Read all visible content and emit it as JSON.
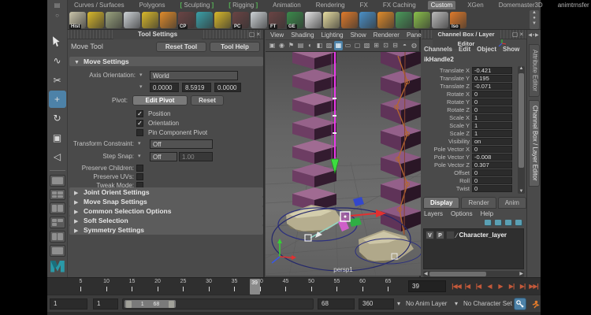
{
  "colors": {
    "accent_blue": "#4d82a8",
    "playback_orange": "#c4593a",
    "bracket_green": "#56b456",
    "selection_pink": "#e83ae8"
  },
  "shelf": {
    "tabs": [
      {
        "label": "Curves / Surfaces"
      },
      {
        "label": "Polygons"
      },
      {
        "label": "Sculpting",
        "bracketed": true
      },
      {
        "label": "Rigging",
        "bracketed": true
      },
      {
        "label": "Animation"
      },
      {
        "label": "Rendering"
      },
      {
        "label": "FX"
      },
      {
        "label": "FX Caching"
      },
      {
        "label": "Custom",
        "active": true
      },
      {
        "label": "XGen"
      },
      {
        "label": "Domemaster3D"
      },
      {
        "label": "animtrnsfer"
      }
    ],
    "icons": [
      {
        "name": "history-icon",
        "color": "#c9c4aa",
        "badge": "Hist"
      },
      {
        "name": "yellow-lattice-icon",
        "color": "#d8b82a"
      },
      {
        "name": "mesh-icon",
        "color": "#9aa37e"
      },
      {
        "name": "knife-icon",
        "color": "#cdd2d6"
      },
      {
        "name": "lattice-icon",
        "color": "#d8b82a"
      },
      {
        "name": "cylinder-icon",
        "color": "#e08b2a"
      },
      {
        "name": "cp-tool-icon",
        "color": "#6a4444",
        "badge": "CP"
      },
      {
        "name": "editor-panel-icon",
        "color": "#3aa0a8"
      },
      {
        "name": "net-icon",
        "color": "#d8b82a"
      },
      {
        "name": "pc-tool-icon",
        "color": "#6a4444",
        "badge": "PC"
      },
      {
        "name": "knife2-icon",
        "color": "#cdd2d6"
      },
      {
        "name": "ft-tool-icon",
        "color": "#6a4444",
        "badge": "FT"
      },
      {
        "name": "ge-tool-icon",
        "color": "#3a8a4a",
        "badge": "GE"
      },
      {
        "name": "white-panel-icon",
        "color": "#e4e4e4"
      },
      {
        "name": "cone-icon",
        "color": "#e6dca0"
      },
      {
        "name": "orange-grid-icon",
        "color": "#e07a2a"
      },
      {
        "name": "blue-brush-icon",
        "color": "#4a90c8"
      },
      {
        "name": "orange-sphere-icon",
        "color": "#e08b2a"
      },
      {
        "name": "green-box-icon",
        "color": "#4a9a5a"
      },
      {
        "name": "green-circle-brush-icon",
        "color": "#8ac04a"
      },
      {
        "name": "brackets-icon",
        "color": "#bbbbbb"
      },
      {
        "name": "iso-house-icon",
        "color": "#e07a2a",
        "badge": "Iso"
      }
    ]
  },
  "toolbox": {
    "tools": [
      {
        "name": "select-tool",
        "glyph": "cursor"
      },
      {
        "name": "lasso-select-tool",
        "glyph": "∿"
      },
      {
        "name": "paint-select-tool",
        "glyph": "✂"
      },
      {
        "name": "move-tool",
        "glyph": "+",
        "active": true
      },
      {
        "name": "rotate-tool",
        "glyph": "↻"
      },
      {
        "name": "scale-tool",
        "glyph": "▣"
      },
      {
        "name": "last-tool",
        "glyph": "◁"
      }
    ],
    "layouts": [
      {
        "name": "layout-single-pane-button",
        "panes": 1
      },
      {
        "name": "layout-four-pane-button",
        "panes": 4
      },
      {
        "name": "layout-two-pane-side-button",
        "panes": 2
      },
      {
        "name": "layout-three-pane-button",
        "panes": 3
      },
      {
        "name": "layout-outliner-persp-button",
        "panes": 2
      },
      {
        "name": "layout-custom-button",
        "panes": 1
      }
    ]
  },
  "tool_settings": {
    "title": "Tool Settings",
    "tool_name": "Move Tool",
    "reset_button": "Reset Tool",
    "help_button": "Tool Help",
    "move_settings_header": "Move Settings",
    "axis_orientation_label": "Axis Orientation:",
    "axis_orientation_value": "World",
    "translate_values": [
      "0.0000",
      "8.5919",
      "0.0000"
    ],
    "pivot_label": "Pivot:",
    "edit_pivot_button": "Edit Pivot",
    "pivot_reset_button": "Reset",
    "checkboxes": [
      {
        "label": "Position",
        "checked": true
      },
      {
        "label": "Orientation",
        "checked": true
      },
      {
        "label": "Pin Component Pivot",
        "checked": false
      }
    ],
    "transform_constraint_label": "Transform Constraint:",
    "transform_constraint_value": "Off",
    "step_snap_label": "Step Snap:",
    "step_snap_value": "Off",
    "step_snap_increment": "1.00",
    "toggle_rows": [
      {
        "label": "Preserve Children:",
        "checked": false
      },
      {
        "label": "Preserve UVs:",
        "checked": false
      },
      {
        "label": "Tweak Mode:",
        "checked": false
      }
    ],
    "collapsed_sections": [
      "Joint Orient Settings",
      "Move Snap Settings",
      "Common Selection Options",
      "Soft Selection",
      "Symmetry Settings"
    ]
  },
  "viewport": {
    "menus": [
      "View",
      "Shading",
      "Lighting",
      "Show",
      "Renderer",
      "Panels"
    ],
    "icons": [
      {
        "name": "select-camera-icon",
        "glyph": "▣"
      },
      {
        "name": "camera-attributes-icon",
        "glyph": "◉"
      },
      {
        "name": "bookmark-icon",
        "glyph": "⚑"
      },
      {
        "name": "image-plane-icon",
        "glyph": "▤"
      },
      {
        "name": "two-sided-lighting-icon",
        "glyph": "◐"
      },
      {
        "name": "shading-icon",
        "glyph": "◧"
      },
      {
        "name": "textured-icon",
        "glyph": "▨"
      },
      {
        "name": "grid-icon",
        "glyph": "▦",
        "active": true
      },
      {
        "name": "film-gate-icon",
        "glyph": "▭"
      },
      {
        "name": "resolution-gate-icon",
        "glyph": "▢"
      },
      {
        "name": "gate-mask-icon",
        "glyph": "▧"
      },
      {
        "name": "field-chart-icon",
        "glyph": "⊞"
      },
      {
        "name": "safe-action-icon",
        "glyph": "⊡"
      },
      {
        "name": "safe-title-icon",
        "glyph": "⊟"
      },
      {
        "name": "frame-rate-icon",
        "glyph": "◓"
      },
      {
        "name": "xray-icon",
        "glyph": "◍"
      }
    ],
    "camera_label": "persp1"
  },
  "channel_box": {
    "title": "Channel Box / Layer Editor",
    "menus": [
      "Channels",
      "Edit",
      "Object",
      "Show"
    ],
    "object_name": "ikHandle2",
    "channels": [
      {
        "label": "Translate X",
        "value": "-0.421"
      },
      {
        "label": "Translate Y",
        "value": "0.195"
      },
      {
        "label": "Translate Z",
        "value": "-0.071"
      },
      {
        "label": "Rotate X",
        "value": "0"
      },
      {
        "label": "Rotate Y",
        "value": "0"
      },
      {
        "label": "Rotate Z",
        "value": "0"
      },
      {
        "label": "Scale X",
        "value": "1"
      },
      {
        "label": "Scale Y",
        "value": "1"
      },
      {
        "label": "Scale Z",
        "value": "1"
      },
      {
        "label": "Visibility",
        "value": "on"
      },
      {
        "label": "Pole Vector X",
        "value": "0"
      },
      {
        "label": "Pole Vector Y",
        "value": "-0.008"
      },
      {
        "label": "Pole Vector Z",
        "value": "0.307"
      },
      {
        "label": "Offset",
        "value": "0"
      },
      {
        "label": "Roll",
        "value": "0"
      },
      {
        "label": "Twist",
        "value": "0"
      }
    ]
  },
  "layer_editor": {
    "tabs": [
      {
        "label": "Display",
        "active": true
      },
      {
        "label": "Render",
        "active": false
      },
      {
        "label": "Anim",
        "active": false
      }
    ],
    "menus": [
      "Layers",
      "Options",
      "Help"
    ],
    "layers": [
      {
        "visibility": "V",
        "playback": "P",
        "name": "Character_layer"
      }
    ]
  },
  "side_tabs": [
    "Attribute Editor",
    "Channel Box / Layer Editor"
  ],
  "timeline": {
    "ticks": [
      5,
      10,
      15,
      20,
      25,
      30,
      35,
      40,
      45,
      50,
      55,
      60,
      65
    ],
    "current_frame": 39,
    "current_frame_field": "39"
  },
  "playback_buttons": [
    {
      "name": "go-to-start-button",
      "glyph": "|◀◀"
    },
    {
      "name": "step-back-frame-button",
      "glyph": "|◀"
    },
    {
      "name": "step-back-key-button",
      "glyph": "|◀"
    },
    {
      "name": "play-backwards-button",
      "glyph": "◀"
    },
    {
      "name": "play-forward-button",
      "glyph": "▶"
    },
    {
      "name": "step-forward-key-button",
      "glyph": "▶|"
    },
    {
      "name": "step-forward-frame-button",
      "glyph": "▶|"
    },
    {
      "name": "go-to-end-button",
      "glyph": "▶▶|"
    }
  ],
  "range_slider": {
    "animation_start": "1",
    "playback_start": "1",
    "range_start_label": "1",
    "range_end_label": "68",
    "playback_end": "68",
    "animation_end": "360",
    "anim_layer": "No Anim Layer",
    "character_set": "No Character Set"
  }
}
